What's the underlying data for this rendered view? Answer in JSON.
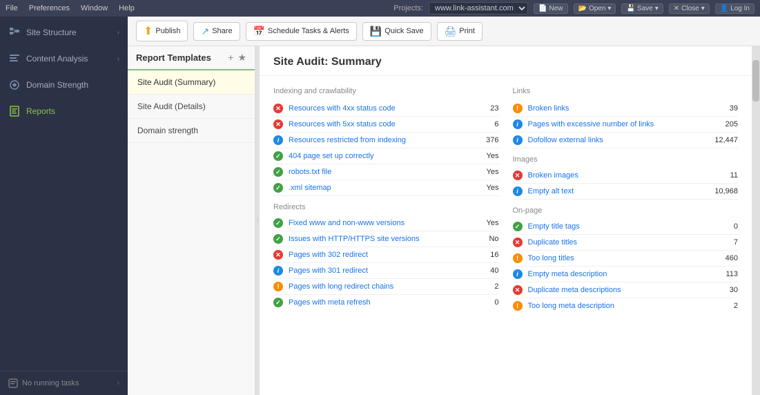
{
  "menubar": {
    "items": [
      "File",
      "Preferences",
      "Window",
      "Help"
    ],
    "project_label": "Projects:",
    "project_value": "www.link-assistant.com",
    "buttons": [
      "New",
      "Open",
      "Save",
      "Close",
      "Log In"
    ]
  },
  "toolbar": {
    "publish_label": "Publish",
    "share_label": "Share",
    "schedule_label": "Schedule Tasks & Alerts",
    "quicksave_label": "Quick Save",
    "print_label": "Print"
  },
  "sidebar": {
    "items": [
      {
        "id": "site-structure",
        "label": "Site Structure"
      },
      {
        "id": "content-analysis",
        "label": "Content Analysis"
      },
      {
        "id": "domain-strength",
        "label": "Domain Strength"
      },
      {
        "id": "reports",
        "label": "Reports"
      }
    ],
    "footer": "No running tasks"
  },
  "templates": {
    "title": "Report Templates",
    "items": [
      {
        "label": "Site Audit (Summary)",
        "active": true
      },
      {
        "label": "Site Audit (Details)",
        "active": false
      },
      {
        "label": "Domain strength",
        "active": false
      }
    ]
  },
  "report": {
    "title": "Site Audit: Summary",
    "sections": {
      "indexing": {
        "title": "Indexing and crawlability",
        "rows": [
          {
            "icon": "red",
            "label": "Resources with 4xx status code",
            "value": "23"
          },
          {
            "icon": "red",
            "label": "Resources with 5xx status code",
            "value": "6"
          },
          {
            "icon": "blue",
            "label": "Resources restricted from indexing",
            "value": "376"
          },
          {
            "icon": "green",
            "label": "404 page set up correctly",
            "value": "Yes"
          },
          {
            "icon": "green",
            "label": "robots.txt file",
            "value": "Yes"
          },
          {
            "icon": "green",
            "label": ".xml sitemap",
            "value": "Yes"
          }
        ]
      },
      "redirects": {
        "title": "Redirects",
        "rows": [
          {
            "icon": "green",
            "label": "Fixed www and non-www versions",
            "value": "Yes"
          },
          {
            "icon": "green",
            "label": "Issues with HTTP/HTTPS site versions",
            "value": "No"
          },
          {
            "icon": "red",
            "label": "Pages with 302 redirect",
            "value": "16"
          },
          {
            "icon": "blue",
            "label": "Pages with 301 redirect",
            "value": "40"
          },
          {
            "icon": "orange",
            "label": "Pages with long redirect chains",
            "value": "2"
          },
          {
            "icon": "green",
            "label": "Pages with meta refresh",
            "value": "0"
          }
        ]
      },
      "links": {
        "title": "Links",
        "rows": [
          {
            "icon": "orange",
            "label": "Broken links",
            "value": "39"
          },
          {
            "icon": "blue",
            "label": "Pages with excessive number of links",
            "value": "205"
          },
          {
            "icon": "blue",
            "label": "Dofollow external links",
            "value": "12,447"
          }
        ]
      },
      "images": {
        "title": "Images",
        "rows": [
          {
            "icon": "red",
            "label": "Broken images",
            "value": "11"
          },
          {
            "icon": "blue",
            "label": "Empty alt text",
            "value": "10,968"
          }
        ]
      },
      "onpage": {
        "title": "On-page",
        "rows": [
          {
            "icon": "green",
            "label": "Empty title tags",
            "value": "0"
          },
          {
            "icon": "red",
            "label": "Duplicate titles",
            "value": "7"
          },
          {
            "icon": "orange",
            "label": "Too long titles",
            "value": "460"
          },
          {
            "icon": "blue",
            "label": "Empty meta description",
            "value": "113"
          },
          {
            "icon": "red",
            "label": "Duplicate meta descriptions",
            "value": "30"
          },
          {
            "icon": "orange",
            "label": "Too long meta description",
            "value": "2"
          }
        ]
      }
    }
  }
}
